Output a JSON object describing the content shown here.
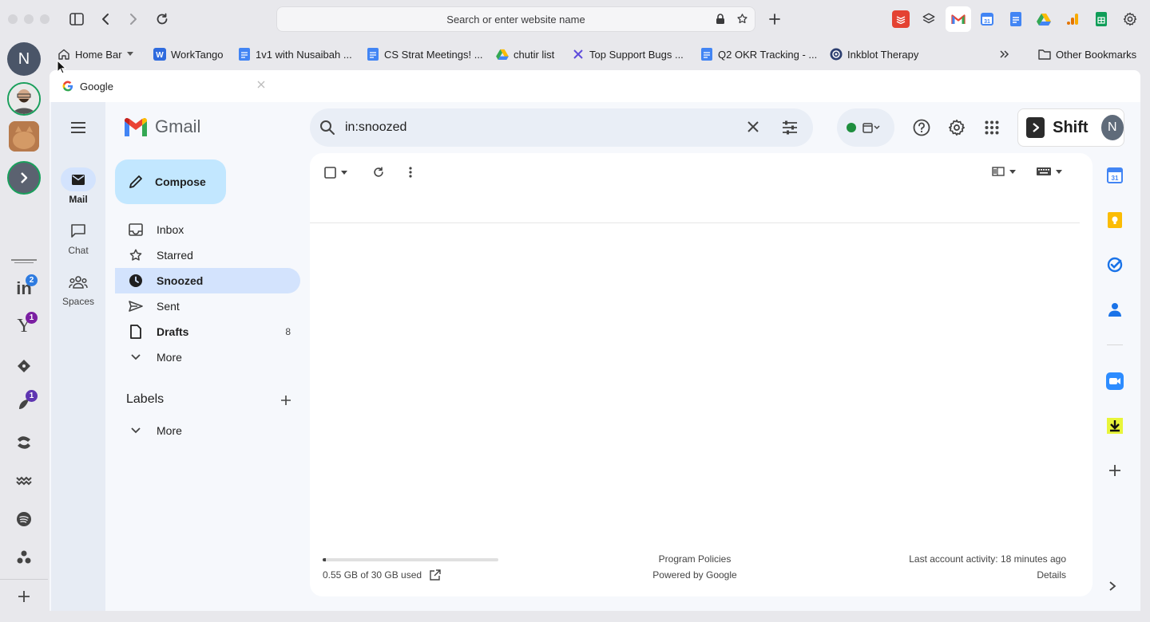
{
  "browser": {
    "url_placeholder": "Search or enter website name",
    "profile_initial": "N"
  },
  "bookmarks": [
    {
      "label": "Home Bar",
      "icon": "home-icon",
      "has_chevron": true
    },
    {
      "label": "WorkTango",
      "icon": "worktango-icon"
    },
    {
      "label": "1v1 with Nusaibah ...",
      "icon": "google-docs-icon"
    },
    {
      "label": "CS Strat Meetings! ...",
      "icon": "google-docs-icon"
    },
    {
      "label": "chutir list",
      "icon": "google-drive-icon"
    },
    {
      "label": "Top Support Bugs ...",
      "icon": "linear-icon"
    },
    {
      "label": "Q2 OKR Tracking - ...",
      "icon": "google-docs-icon"
    },
    {
      "label": "Inkblot Therapy",
      "icon": "inkblot-icon"
    }
  ],
  "other_bookmarks": "Other Bookmarks",
  "rail": {
    "badges": {
      "linkedin": "2",
      "yahoo": "1",
      "app": "1"
    }
  },
  "tab": {
    "title": "Google"
  },
  "gmail": {
    "logo_text": "Gmail",
    "compose": "Compose",
    "search_value": "in:snoozed",
    "shift_label": "Shift",
    "account_initial": "N",
    "mini_rail": [
      {
        "label": "Mail",
        "active": true
      },
      {
        "label": "Chat"
      },
      {
        "label": "Spaces"
      }
    ],
    "nav": [
      {
        "label": "Inbox",
        "icon": "inbox-icon"
      },
      {
        "label": "Starred",
        "icon": "star-icon"
      },
      {
        "label": "Snoozed",
        "icon": "clock-icon",
        "active": true
      },
      {
        "label": "Sent",
        "icon": "send-icon"
      },
      {
        "label": "Drafts",
        "icon": "draft-icon",
        "count": "8"
      },
      {
        "label": "More",
        "icon": "chevron-down-icon"
      }
    ],
    "labels_heading": "Labels",
    "labels_more": "More",
    "footer": {
      "storage": "0.55 GB of 30 GB used",
      "storage_fraction": 0.018,
      "program_policies": "Program Policies",
      "powered_by": "Powered by Google",
      "last_activity": "Last account activity: 18 minutes ago",
      "details": "Details"
    }
  },
  "colors": {
    "snoozed_bg": "#d3e3fd",
    "compose_bg": "#c2e7ff",
    "gmail_red": "#ea4335"
  }
}
